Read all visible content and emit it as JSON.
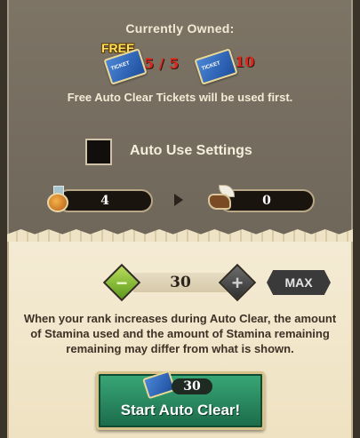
{
  "owned": {
    "heading": "Currently Owned:",
    "free_badge": "FREE",
    "free_count": "5 / 5",
    "paid_count": "10",
    "note": "Free Auto Clear Tickets will be used first."
  },
  "auto_use": {
    "label": "Auto Use Settings",
    "checked": false,
    "stamina_item_value": "4",
    "boot_item_value": "0"
  },
  "quantity": {
    "value": "30",
    "max_label": "MAX"
  },
  "rank_note": {
    "line1": "When your rank increases during Auto Clear, the amount",
    "line2": "of Stamina used and the amount of Stamina remaining",
    "line3": "remaining may differ from what is shown."
  },
  "start": {
    "ticket_count": "30",
    "label": "Start Auto Clear!"
  },
  "colors": {
    "panel_dark": "#7d7466",
    "parchment": "#f4ebd4",
    "accent_green": "#1b6b49",
    "count_red": "#e2231a"
  }
}
